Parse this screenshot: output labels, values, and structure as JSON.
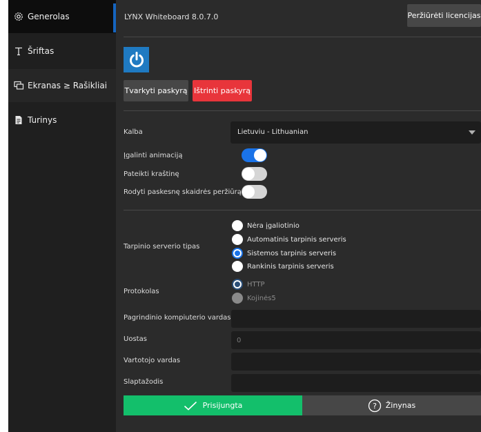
{
  "sidebar": {
    "items": [
      {
        "icon": "settings-gear-icon",
        "label": "Generolas"
      },
      {
        "icon": "font-t-icon",
        "label": "Šriftas"
      },
      {
        "icon": "screens-icon",
        "label": "Ekranas ≥ Rašikliai"
      },
      {
        "icon": "document-icon",
        "label": "Turinys"
      }
    ],
    "active_index": 0
  },
  "header": {
    "title": "LYNX Whiteboard 8.0.7.0",
    "license_button": "Peržiūrėti licencijas"
  },
  "account": {
    "logo_icon": "power-logo-icon",
    "manage_button": "Tvarkyti paskyrą",
    "delete_button": "Ištrinti paskyrą"
  },
  "settings": {
    "language_label": "Kalba",
    "language_value": "Lietuviu - Lithuanian",
    "toggles": [
      {
        "label": "Įgalinti animaciją",
        "on": true
      },
      {
        "label": "Pateikti kraštinę",
        "on": false
      },
      {
        "label": "Rodyti paskesnę skaidrės peržiūrą",
        "on": false
      }
    ]
  },
  "proxy": {
    "label": "Tarpinio serverio tipas",
    "options": [
      "Nėra įgaliotinio",
      "Automatinis tarpinis serveris",
      "Sistemos tarpinis serveris",
      "Rankinis tarpinis serveris"
    ],
    "selected_index": 2,
    "protocol_label": "Protokolas",
    "protocols": [
      "HTTP",
      "Kojinės5"
    ],
    "protocol_selected_index": 0,
    "host_label": "Pagrindinio kompiuterio vardas",
    "host_value": "",
    "port_label": "Uostas",
    "port_placeholder": "0",
    "user_label": "Vartotojo vardas",
    "user_value": "",
    "password_label": "Slaptažodis",
    "password_value": ""
  },
  "footer": {
    "connected_label": "Prisijungta",
    "connected_icon": "checkmark-icon",
    "help_label": "Žinynas",
    "help_icon": "question-circle-icon"
  },
  "colors": {
    "accent_blue": "#1a73e8",
    "danger_red": "#e8353b",
    "success_green": "#13bf6b",
    "logo_blue": "#1f7ac2"
  }
}
